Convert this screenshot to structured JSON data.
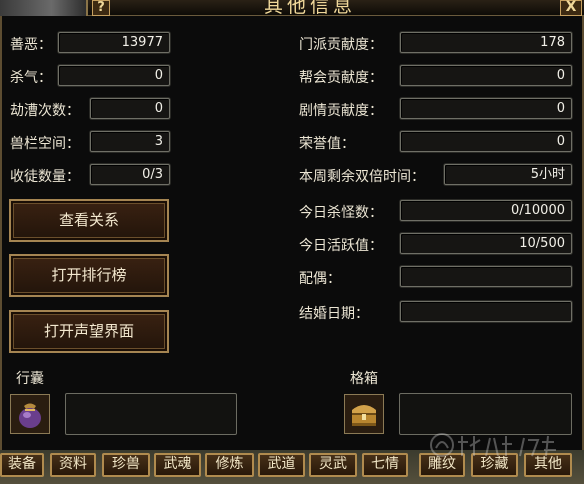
{
  "window": {
    "title": "其他信息",
    "help_label": "?",
    "close_label": "X"
  },
  "left_stats": [
    {
      "label": "善恶：",
      "value": "13977"
    },
    {
      "label": "杀气：",
      "value": "0"
    },
    {
      "label": "劫漕次数：",
      "value": "0"
    },
    {
      "label": "兽栏空间：",
      "value": "3"
    },
    {
      "label": "收徒数量：",
      "value": "0/3"
    }
  ],
  "right_stats": [
    {
      "label": "门派贡献度：",
      "value": "178"
    },
    {
      "label": "帮会贡献度：",
      "value": "0"
    },
    {
      "label": "剧情贡献度：",
      "value": "0"
    },
    {
      "label": "荣誉值：",
      "value": "0"
    },
    {
      "label": "本周剩余双倍时间：",
      "value": "5小时"
    },
    {
      "label": "今日杀怪数：",
      "value": "0/10000"
    },
    {
      "label": "今日活跃值：",
      "value": "10/500"
    },
    {
      "label": "配偶：",
      "value": ""
    },
    {
      "label": "结婚日期：",
      "value": ""
    }
  ],
  "buttons": {
    "view_relations": "查看关系",
    "open_rankings": "打开排行榜",
    "open_reputation": "打开声望界面"
  },
  "bag": {
    "label": "行囊",
    "icon": "purple-pouch-icon"
  },
  "grid_box": {
    "label": "格箱",
    "icon": "golden-chest-icon"
  },
  "tabs": [
    "装备",
    "资料",
    "珍兽",
    "武魂",
    "修炼",
    "武道",
    "灵武",
    "七情",
    "雕纹",
    "珍藏",
    "其他"
  ],
  "colors": {
    "gold_border": "#b08b4e",
    "button_bg": "#2e1a0c",
    "field_border": "#6f6f66",
    "text": "#ece6d4"
  }
}
